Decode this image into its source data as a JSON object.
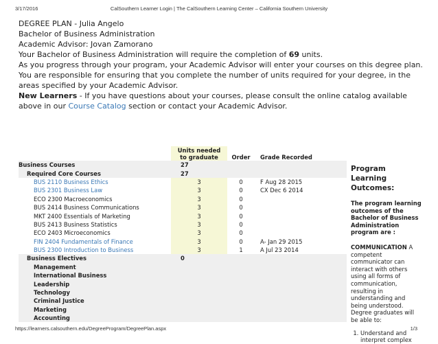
{
  "print_header": {
    "date": "3/17/2016",
    "title": "CalSouthern Learner Login | The CalSouthern Learning Center – California Southern University"
  },
  "print_footer": {
    "url": "https://learners.calsouthern.edu/DegreeProgram/DegreePlan.aspx",
    "page": "1/3"
  },
  "plan": {
    "title_line": "DEGREE PLAN - Julia Angelo",
    "degree_line": "Bachelor of Business Administration",
    "advisor_line": "Academic Advisor: Jovan Zamorano",
    "requirement_prefix": "Your Bachelor of Business Administration will require the completion of ",
    "requirement_units": "69",
    "requirement_suffix": " units.",
    "description": "As you progress through your program, your Academic Advisor will enter your courses on this degree plan. You are responsible for ensuring that you complete the number of units required for your degree, in the areas specified by your Academic Advisor.",
    "new_learners_label": "New Learners",
    "new_learners_text": " - If you have questions about your courses, please consult the online catalog available above in our ",
    "catalog_link": "Course Catalog",
    "new_learners_tail": " section or contact your Academic Advisor."
  },
  "table": {
    "headers": {
      "units_line1": "Units needed",
      "units_line2": "to graduate",
      "order": "Order",
      "grade": "Grade Recorded"
    },
    "business_courses": {
      "label": "Business Courses",
      "units": "27"
    },
    "required_core": {
      "label": "Required Core Courses",
      "units": "27"
    },
    "courses": [
      {
        "name": "BUS 2110 Business Ethics",
        "units": "3",
        "order": "0",
        "grade": "F   Aug 28 2015",
        "link": true
      },
      {
        "name": "BUS 2301 Business Law",
        "units": "3",
        "order": "0",
        "grade": "CX   Dec 6 2014",
        "link": true
      },
      {
        "name": "ECO 2300 Macroeconomics",
        "units": "3",
        "order": "0",
        "grade": "",
        "link": false
      },
      {
        "name": "BUS 2414 Business Communications",
        "units": "3",
        "order": "0",
        "grade": "",
        "link": false
      },
      {
        "name": "MKT 2400 Essentials of Marketing",
        "units": "3",
        "order": "0",
        "grade": "",
        "link": false
      },
      {
        "name": "BUS 2413 Business Statistics",
        "units": "3",
        "order": "0",
        "grade": "",
        "link": false
      },
      {
        "name": "ECO 2403 Microeconomics",
        "units": "3",
        "order": "0",
        "grade": "",
        "link": false
      },
      {
        "name": "FIN 2404 Fundamentals of Finance",
        "units": "3",
        "order": "0",
        "grade": "A-   Jan 29 2015",
        "link": true
      },
      {
        "name": "BUS 2300 Introduction to Business",
        "units": "3",
        "order": "1",
        "grade": "A   Jul 23 2014",
        "link": true
      }
    ],
    "business_electives": {
      "label": "Business Electives",
      "units": "0"
    },
    "electives": [
      "Management",
      "International Business",
      "Leadership",
      "Technology",
      "Criminal Justice",
      "Marketing",
      "Accounting"
    ]
  },
  "outcomes": {
    "heading": "Program Learning Outcomes:",
    "subheading": "The program learning outcomes of the Bachelor of Business Administration program are :",
    "comm_label": "COMMUNICATION",
    "comm_text": " A competent communicator can interact with others using all forms of communication, resulting in understanding and being understood. Degree graduates will be able to:",
    "items": [
      "Understand and interpret complex"
    ]
  }
}
